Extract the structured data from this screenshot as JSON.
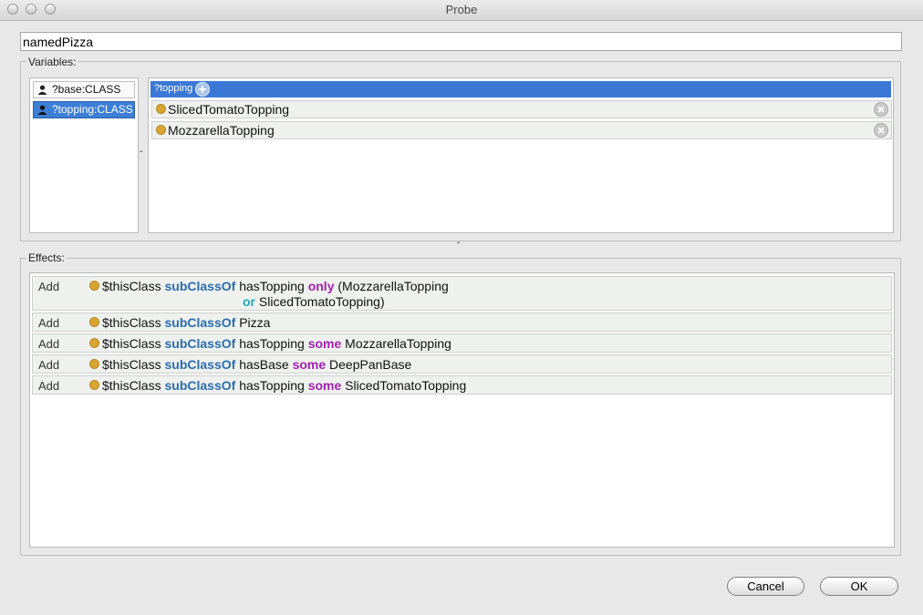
{
  "window": {
    "title": "Probe"
  },
  "name_field": {
    "value": "namedPizza"
  },
  "variables": {
    "label": "Variables:",
    "items": [
      {
        "label": "?base:CLASS",
        "selected": false
      },
      {
        "label": "?topping:CLASS",
        "selected": true
      }
    ],
    "detail": {
      "header": "?topping",
      "values": [
        "SlicedTomatoTopping",
        "MozzarellaTopping"
      ]
    }
  },
  "effects": {
    "label": "Effects:",
    "rows": [
      {
        "action": "Add",
        "subject": "$thisClass",
        "rel": "subClassOf",
        "prop": "hasTopping",
        "quant": "only",
        "filler": "(MozzarellaTopping",
        "or_kw": "or",
        "or_filler": "SlicedTomatoTopping)"
      },
      {
        "action": "Add",
        "subject": "$thisClass",
        "rel": "subClassOf",
        "prop": "Pizza"
      },
      {
        "action": "Add",
        "subject": "$thisClass",
        "rel": "subClassOf",
        "prop": "hasTopping",
        "quant": "some",
        "filler": "MozzarellaTopping"
      },
      {
        "action": "Add",
        "subject": "$thisClass",
        "rel": "subClassOf",
        "prop": "hasBase",
        "quant": "some",
        "filler": "DeepPanBase"
      },
      {
        "action": "Add",
        "subject": "$thisClass",
        "rel": "subClassOf",
        "prop": "hasTopping",
        "quant": "some",
        "filler": "SlicedTomatoTopping"
      }
    ]
  },
  "buttons": {
    "cancel": "Cancel",
    "ok": "OK"
  },
  "colors": {
    "selection": "#3d7fd6",
    "keyword_blue": "#2a6cb0",
    "keyword_purple": "#a31fb2",
    "keyword_teal": "#21a7b5",
    "class_dot": "#d8a432"
  }
}
